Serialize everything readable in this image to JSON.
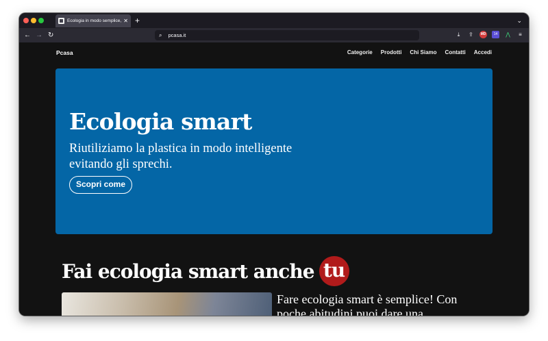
{
  "browser": {
    "tab_title": "Ecologia in modo semplice, pro",
    "tab_close": "✕",
    "new_tab": "+",
    "tab_list": "⌄",
    "url": "pcasa.it",
    "nav": {
      "back": "←",
      "forward": "→",
      "reload": "↻",
      "search": "⌕"
    },
    "toolbar": {
      "download": "⤓",
      "share": "⇪",
      "ext1": "MD",
      "ext2": "14",
      "ext3": "⋀",
      "menu": "≡"
    }
  },
  "site": {
    "logo": "Pcasa",
    "nav": [
      "Categorie",
      "Prodotti",
      "Chi Siamo",
      "Contatti",
      "Accedi"
    ]
  },
  "hero": {
    "title": "Ecologia smart",
    "subtitle": "Riutiliziamo la plastica in modo intelligente evitando gli sprechi.",
    "cta": "Scopri come",
    "color": "#0466a6"
  },
  "section": {
    "title": "Fai ecologia smart anche",
    "badge": "tu",
    "badge_color": "#b11b1b",
    "text": "Fare ecologia smart è semplice! Con poche abitudini puoi dare una"
  }
}
